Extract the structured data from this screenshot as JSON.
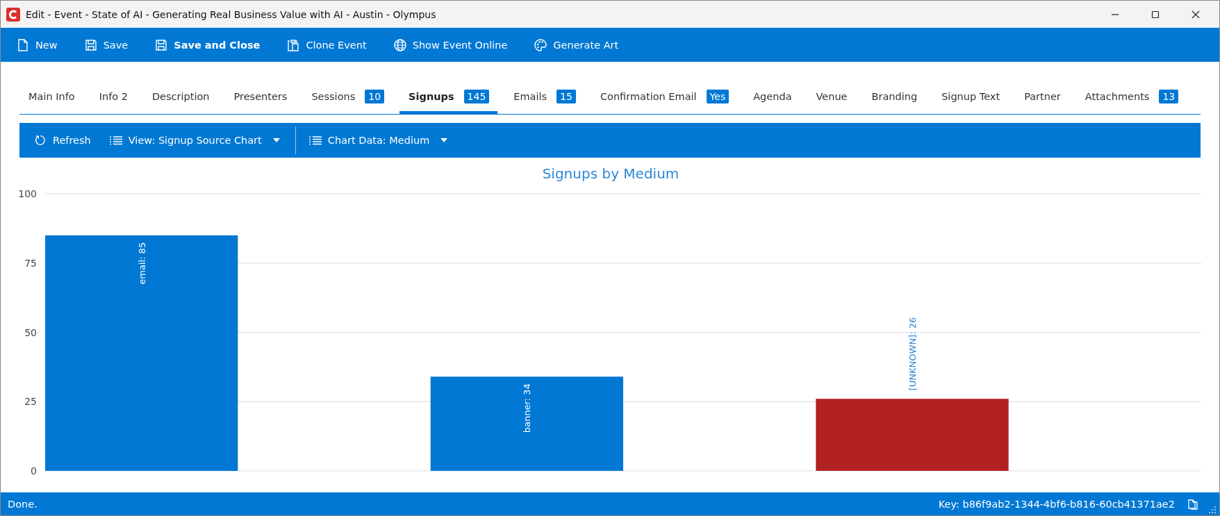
{
  "window": {
    "title": "Edit - Event - State of AI - Generating Real Business Value with AI - Austin - Olympus"
  },
  "toolbar": [
    {
      "kind": "new",
      "label": "New",
      "bold": false
    },
    {
      "kind": "save",
      "label": "Save",
      "bold": false
    },
    {
      "kind": "save",
      "label": "Save and Close",
      "bold": true
    },
    {
      "kind": "clone",
      "label": "Clone Event",
      "bold": false
    },
    {
      "kind": "globe",
      "label": "Show Event Online",
      "bold": false
    },
    {
      "kind": "palette",
      "label": "Generate Art",
      "bold": false
    }
  ],
  "tabs": [
    {
      "label": "Main Info",
      "selected": false
    },
    {
      "label": "Info 2",
      "selected": false
    },
    {
      "label": "Description",
      "selected": false
    },
    {
      "label": "Presenters",
      "selected": false
    },
    {
      "label": "Sessions",
      "selected": false,
      "badge": "10"
    },
    {
      "label": "Signups",
      "selected": true,
      "badge": "145"
    },
    {
      "label": "Emails",
      "selected": false,
      "badge": "15"
    },
    {
      "label": "Confirmation Email",
      "selected": false,
      "badge": "Yes"
    },
    {
      "label": "Agenda",
      "selected": false
    },
    {
      "label": "Venue",
      "selected": false
    },
    {
      "label": "Branding",
      "selected": false
    },
    {
      "label": "Signup Text",
      "selected": false
    },
    {
      "label": "Partner",
      "selected": false
    },
    {
      "label": "Attachments",
      "selected": false,
      "badge": "13"
    }
  ],
  "chart_toolbar": [
    {
      "kind": "refresh",
      "label": "Refresh"
    },
    {
      "kind": "dropdown",
      "label": "View: Signup Source Chart"
    },
    {
      "kind": "dropdown",
      "label": "Chart Data: Medium"
    }
  ],
  "chart": {
    "chart_data": {
      "type": "bar",
      "title": "Signups by Medium",
      "stacked": true,
      "grid": true,
      "series": [
        {
          "color": "#0078d4",
          "values": [
            85,
            34,
            null
          ]
        },
        {
          "color": "#b22222",
          "values": [
            null,
            null,
            26
          ]
        }
      ],
      "ylim": [
        0,
        100
      ],
      "yticks": [
        0,
        25,
        50,
        75,
        100
      ],
      "value_labels": [
        "email: 85",
        "banner: 34",
        "[UNKNOWN]: 26"
      ]
    }
  },
  "status_bar": {
    "message": "Done.",
    "key": "Key: b86f9ab2-1344-4bf6-b816-60cb41371ae2"
  }
}
